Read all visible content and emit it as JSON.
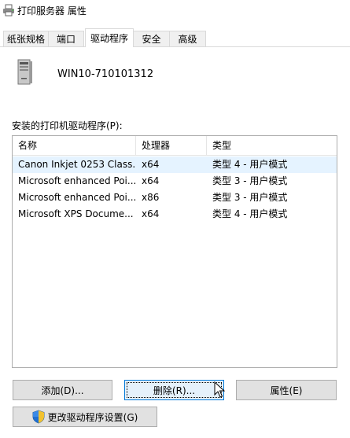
{
  "window": {
    "title": "打印服务器 属性"
  },
  "tabs": [
    {
      "label": "纸张规格",
      "active": false
    },
    {
      "label": "端口",
      "active": false
    },
    {
      "label": "驱动程序",
      "active": true
    },
    {
      "label": "安全",
      "active": false
    },
    {
      "label": "高级",
      "active": false
    }
  ],
  "server": {
    "name": "WIN10-710101312",
    "icon": "server-tower-icon"
  },
  "drivers": {
    "label": "安装的打印机驱动程序(P):",
    "columns": [
      "名称",
      "处理器",
      "类型"
    ],
    "rows": [
      {
        "name": "Canon Inkjet 0253 Class...",
        "processor": "x64",
        "type": "类型 4 - 用户模式"
      },
      {
        "name": "Microsoft enhanced Poi...",
        "processor": "x64",
        "type": "类型 3 - 用户模式"
      },
      {
        "name": "Microsoft enhanced Poi...",
        "processor": "x86",
        "type": "类型 3 - 用户模式"
      },
      {
        "name": "Microsoft XPS Docume...",
        "processor": "x64",
        "type": "类型 4 - 用户模式"
      }
    ]
  },
  "buttons": {
    "add": "添加(D)...",
    "remove": "删除(R)...",
    "properties": "属性(E)",
    "change_settings": "更改驱动程序设置(G)"
  },
  "colors": {
    "accent": "#0078d7",
    "row_hover": "#e5f3ff",
    "button_face": "#e1e1e1"
  }
}
